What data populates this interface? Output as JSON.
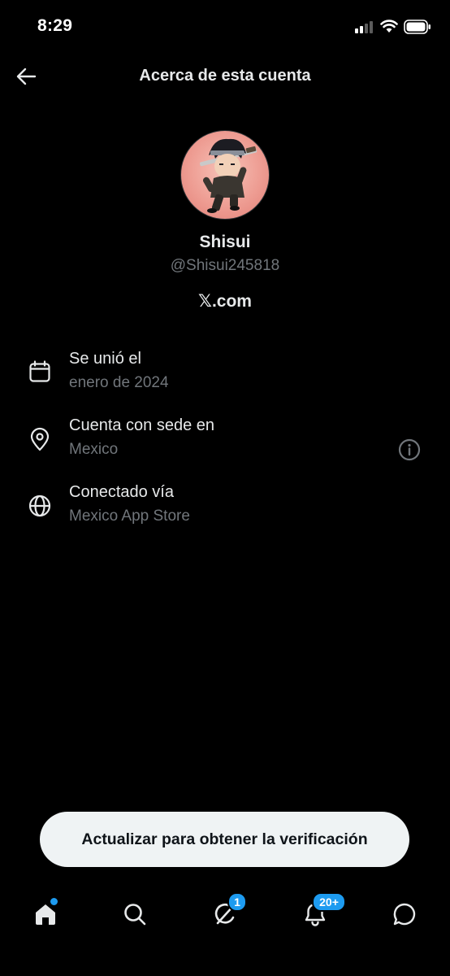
{
  "status_bar": {
    "time": "8:29"
  },
  "header": {
    "title": "Acerca de esta cuenta"
  },
  "profile": {
    "name": "Shisui",
    "handle": "@Shisui245818",
    "site": "𝕏.com"
  },
  "info_rows": [
    {
      "icon": "calendar-icon",
      "title": "Se unió el",
      "value": "enero de 2024"
    },
    {
      "icon": "location-pin-icon",
      "title": "Cuenta con sede en",
      "value": "Mexico"
    },
    {
      "icon": "globe-icon",
      "title": "Conectado vía",
      "value": "Mexico App Store"
    }
  ],
  "verify_button": {
    "label": "Actualizar para obtener la verificación"
  },
  "bottom_nav": {
    "items": [
      {
        "name": "home",
        "icon": "home-icon",
        "active": true,
        "dot": true
      },
      {
        "name": "search",
        "icon": "search-icon"
      },
      {
        "name": "grok",
        "icon": "grok-icon",
        "badge": "1"
      },
      {
        "name": "notifications",
        "icon": "bell-icon",
        "badge": "20+"
      },
      {
        "name": "messages",
        "icon": "chat-bubble-icon"
      }
    ]
  },
  "colors": {
    "background": "#000000",
    "primary_text": "#e7e9ea",
    "secondary_text": "#71767b",
    "accent": "#1d9bf0",
    "pill_background": "#eff3f4"
  }
}
